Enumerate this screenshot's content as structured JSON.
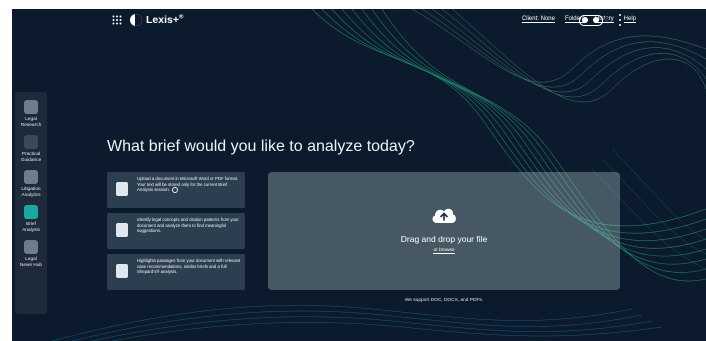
{
  "header": {
    "brand": "Lexis+",
    "brand_superscript": "®",
    "nav": [
      "Client: None",
      "Folders",
      "History",
      "Help"
    ]
  },
  "sidebar": {
    "items": [
      {
        "label": "Legal\nResearch",
        "icon": "legal-research-icon"
      },
      {
        "label": "Practical\nGuidance",
        "icon": "practical-guidance-icon"
      },
      {
        "label": "Litigation\nAnalytics",
        "icon": "litigation-analytics-icon"
      },
      {
        "label": "Brief\nAnalysis",
        "icon": "brief-analysis-icon",
        "active": true
      },
      {
        "label": "Legal\nNews Hub",
        "icon": "legal-news-hub-icon"
      }
    ]
  },
  "main": {
    "headline": "What brief would you like to analyze today?",
    "features": [
      {
        "text": "Upload a document in Microsoft Word or PDF format. Your text will be stored only for the current Brief Analysis session."
      },
      {
        "text": "Identify legal concepts and citation patterns from your document and analyze them to find meaningful suggestions."
      },
      {
        "text": "Highlights passages from your document with relevant case recommendations, similar briefs and a full Shepard's® analysis."
      }
    ],
    "dropzone": {
      "title": "Drag and drop your file",
      "browse": "or browse",
      "support_note": "We support DOC, DOCX, and PDFs."
    }
  },
  "colors": {
    "background": "#0b1a2c",
    "accent": "#1aa9a0",
    "sidebar": "#1c2a3b"
  }
}
